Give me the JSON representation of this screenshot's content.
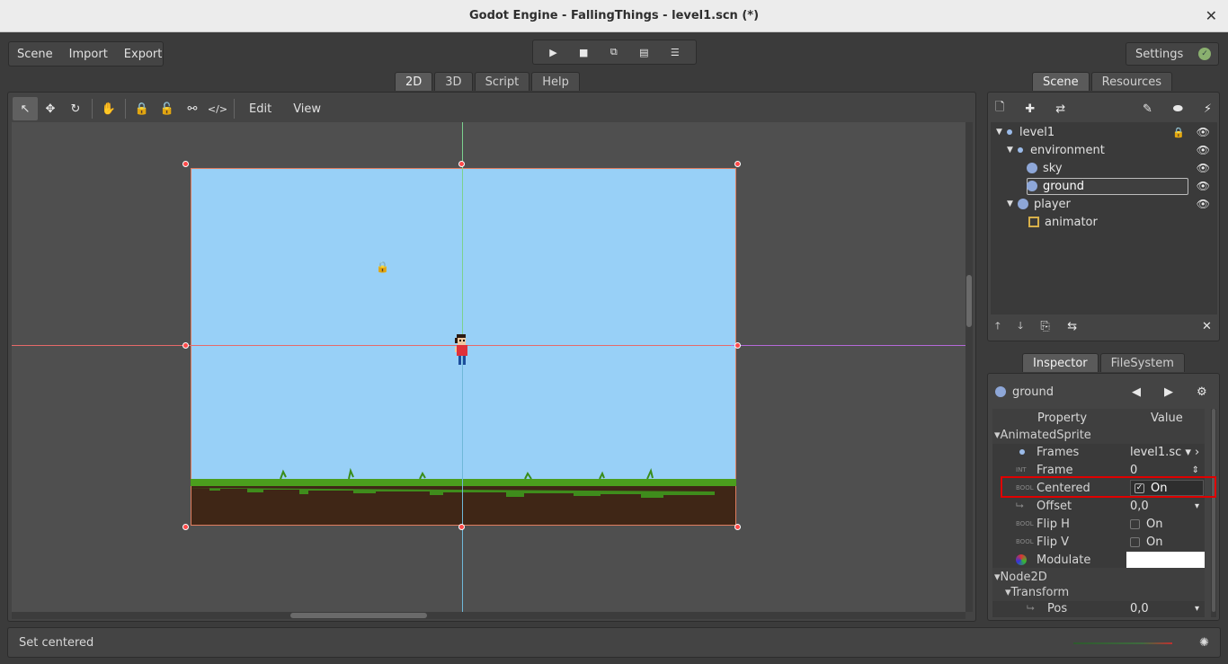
{
  "window": {
    "title": "Godot Engine - FallingThings - level1.scn (*)",
    "close_glyph": "✕"
  },
  "top_menu": {
    "scene": "Scene",
    "import": "Import",
    "export": "Export"
  },
  "play_controls": {
    "play": "▶",
    "stop": "■",
    "play_scene": "⧉",
    "play_custom": "▤",
    "deploy": "☰"
  },
  "settings": {
    "label": "Settings",
    "status": "✓"
  },
  "main_tabs": [
    {
      "label": "2D"
    },
    {
      "label": "3D"
    },
    {
      "label": "Script"
    },
    {
      "label": "Help"
    }
  ],
  "toolbar_2d": {
    "select": "↖",
    "move": "✥",
    "rotate": "↻",
    "pan": "✋",
    "lock": "🔒",
    "unlock": "🔓",
    "group": "⚯",
    "ungroup": "</>",
    "edit": "Edit",
    "view": "View"
  },
  "status": {
    "message": "Set centered",
    "spinner": "✺"
  },
  "scene_dock": {
    "tabs": [
      {
        "label": "Scene"
      },
      {
        "label": "Resources"
      }
    ],
    "toolbar": {
      "new_node": "🗋",
      "add": "✚",
      "replace": "⇄",
      "script": "✎",
      "link": "⬬",
      "signal": "⚡"
    },
    "tree": [
      {
        "label": "level1",
        "arrow": "▼",
        "lock": "🔒",
        "eye": "👁"
      },
      {
        "label": "environment",
        "arrow": "▼",
        "eye": "👁"
      },
      {
        "label": "sky",
        "eye": "👁"
      },
      {
        "label": "ground",
        "eye": "👁"
      },
      {
        "label": "player",
        "arrow": "▼",
        "eye": "👁"
      },
      {
        "label": "animator"
      }
    ],
    "bottom": {
      "up": "🡑",
      "down": "🡓",
      "duplicate": "⎘",
      "reparent": "⇆",
      "delete": "✕"
    }
  },
  "inspector": {
    "tabs": [
      {
        "label": "Inspector"
      },
      {
        "label": "FileSystem"
      }
    ],
    "object_name": "ground",
    "nav_back": "◀",
    "nav_forward": "▶",
    "gear": "⚙",
    "header": {
      "property": "Property",
      "value": "Value"
    },
    "sections": {
      "animated_sprite": "▾AnimatedSprite",
      "node2d": "▾Node2D",
      "transform": "▾Transform"
    },
    "props": {
      "frames": {
        "name": "Frames",
        "value": "level1.sc ▾ ›"
      },
      "frame": {
        "type": "INT",
        "name": "Frame",
        "value": "0",
        "end": "⇕"
      },
      "centered": {
        "type": "BOOL",
        "name": "Centered",
        "check": "✓",
        "value": "On"
      },
      "offset": {
        "name": "Offset",
        "value": "0,0",
        "end": "▾"
      },
      "flip_h": {
        "type": "BOOL",
        "name": "Flip H",
        "value": "On"
      },
      "flip_v": {
        "type": "BOOL",
        "name": "Flip V",
        "value": "On"
      },
      "modulate": {
        "name": "Modulate",
        "color": "#ffffff"
      },
      "pos": {
        "name": "Pos",
        "value": "0,0",
        "end": "▾"
      }
    }
  }
}
